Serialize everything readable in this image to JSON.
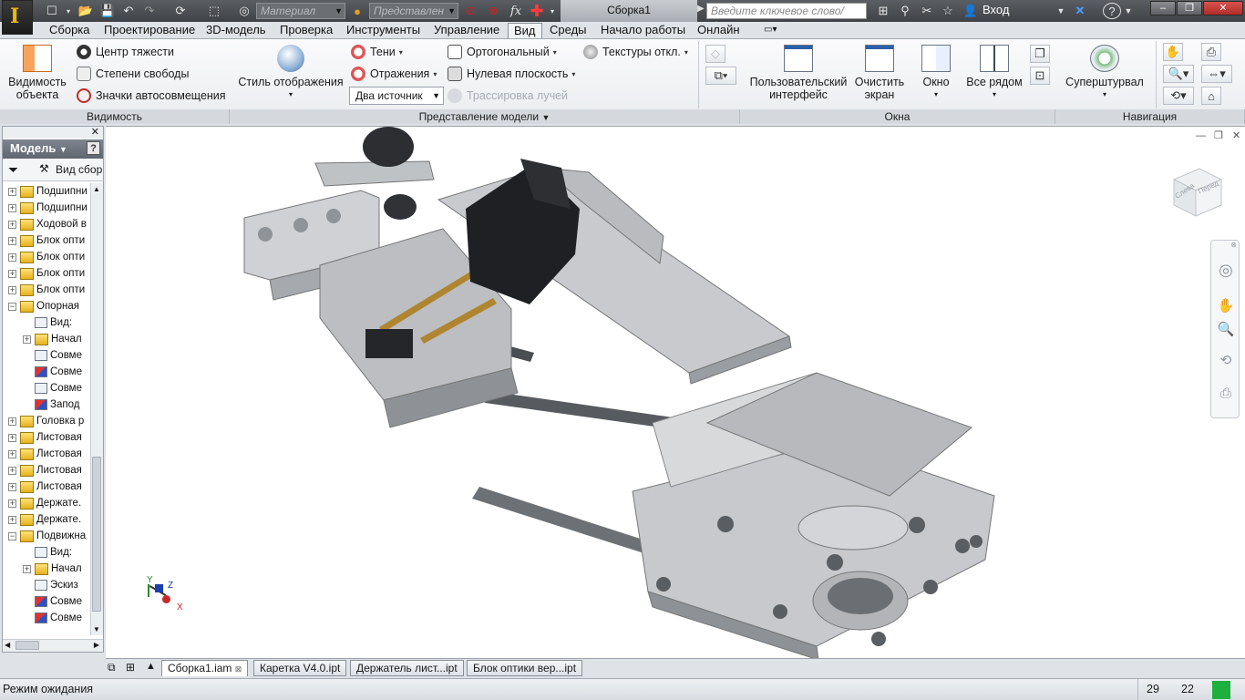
{
  "titlebar": {
    "material_placeholder": "Материал",
    "representation_placeholder": "Представлен",
    "document_title": "Сборка1",
    "search_placeholder": "Введите ключевое слово/фразу",
    "login_label": "Вход",
    "window_buttons": [
      "–",
      "❐",
      "✕"
    ]
  },
  "tabs": [
    "Сборка",
    "Проектирование",
    "3D-модель",
    "Проверка",
    "Инструменты",
    "Управление",
    "Вид",
    "Среды",
    "Начало работы",
    "Онлайн"
  ],
  "active_tab": "Вид",
  "ribbon": {
    "visibility": {
      "object_visibility_line1": "Видимость",
      "object_visibility_line2": "объекта",
      "center_of_gravity": "Центр тяжести",
      "degrees_of_freedom": "Степени свободы",
      "autoconstraint_icons": "Значки автосовмещения",
      "title": "Видимость"
    },
    "model_view": {
      "display_style": "Стиль отображения",
      "shadows": "Тени",
      "reflections": "Отражения",
      "lighting": "Два источник",
      "orthographic": "Ортогональный",
      "ground_plane": "Нулевая плоскость",
      "textures": "Текстуры откл.",
      "ray_tracing": "Трассировка лучей",
      "title": "Представление модели"
    },
    "windows": {
      "user_interface_line1": "Пользовательский",
      "user_interface_line2": "интерфейс",
      "clean_screen_line1": "Очистить",
      "clean_screen_line2": "экран",
      "window": "Окно",
      "tile": "Все рядом",
      "title": "Окна"
    },
    "navigation": {
      "steering_wheels": "Суперштурвал",
      "title": "Навигация"
    }
  },
  "browser": {
    "title": "Модель",
    "view_label": "Вид сбор",
    "items": [
      {
        "label": "Подшипни",
        "type": "folder",
        "level": 0,
        "expand": "+"
      },
      {
        "label": "Подшипни",
        "type": "folder",
        "level": 0,
        "expand": "+"
      },
      {
        "label": "Ходовой в",
        "type": "folder",
        "level": 0,
        "expand": "+"
      },
      {
        "label": "Блок опти",
        "type": "folder",
        "level": 0,
        "expand": "+"
      },
      {
        "label": "Блок опти",
        "type": "folder",
        "level": 0,
        "expand": "+"
      },
      {
        "label": "Блок опти",
        "type": "folder",
        "level": 0,
        "expand": "+"
      },
      {
        "label": "Блок опти",
        "type": "folder",
        "level": 0,
        "expand": "+"
      },
      {
        "label": "Опорная",
        "type": "folder",
        "level": 0,
        "expand": "−"
      },
      {
        "label": "Вид:",
        "type": "leaf",
        "level": 1,
        "expand": ""
      },
      {
        "label": "Начал",
        "type": "folder",
        "level": 1,
        "expand": "+"
      },
      {
        "label": "Совме",
        "type": "leaf",
        "level": 1,
        "expand": ""
      },
      {
        "label": "Совме",
        "type": "leaf-red",
        "level": 1,
        "expand": ""
      },
      {
        "label": "Совме",
        "type": "leaf",
        "level": 1,
        "expand": ""
      },
      {
        "label": "Запод",
        "type": "leaf-red",
        "level": 1,
        "expand": ""
      },
      {
        "label": "Головка р",
        "type": "folder",
        "level": 0,
        "expand": "+"
      },
      {
        "label": "Листовая",
        "type": "folder",
        "level": 0,
        "expand": "+"
      },
      {
        "label": "Листовая",
        "type": "folder",
        "level": 0,
        "expand": "+"
      },
      {
        "label": "Листовая",
        "type": "folder",
        "level": 0,
        "expand": "+"
      },
      {
        "label": "Листовая",
        "type": "folder",
        "level": 0,
        "expand": "+"
      },
      {
        "label": "Держате.",
        "type": "folder",
        "level": 0,
        "expand": "+"
      },
      {
        "label": "Держате.",
        "type": "folder",
        "level": 0,
        "expand": "+"
      },
      {
        "label": "Подвижна",
        "type": "folder",
        "level": 0,
        "expand": "−"
      },
      {
        "label": "Вид:",
        "type": "leaf",
        "level": 1,
        "expand": ""
      },
      {
        "label": "Начал",
        "type": "folder",
        "level": 1,
        "expand": "+"
      },
      {
        "label": "Эскиз",
        "type": "leaf",
        "level": 1,
        "expand": ""
      },
      {
        "label": "Совме",
        "type": "leaf-red",
        "level": 1,
        "expand": ""
      },
      {
        "label": "Совме",
        "type": "leaf-red",
        "level": 1,
        "expand": ""
      }
    ]
  },
  "viewcube": {
    "face_top": "Перед",
    "face_left": "Слева"
  },
  "triad": {
    "x": "X",
    "y": "Y",
    "z": "Z"
  },
  "document_tabs": [
    "Сборка1.iam",
    "Каретка V4.0.ipt",
    "Держатель лист...ipt",
    "Блок оптики вер...ipt"
  ],
  "active_document_tab": "Сборка1.iam",
  "status": {
    "text": "Режим ожидания",
    "count1": "29",
    "count2": "22"
  },
  "colors": {
    "accent_tab": "#f2f4f6",
    "status_ok": "#1db03c"
  }
}
